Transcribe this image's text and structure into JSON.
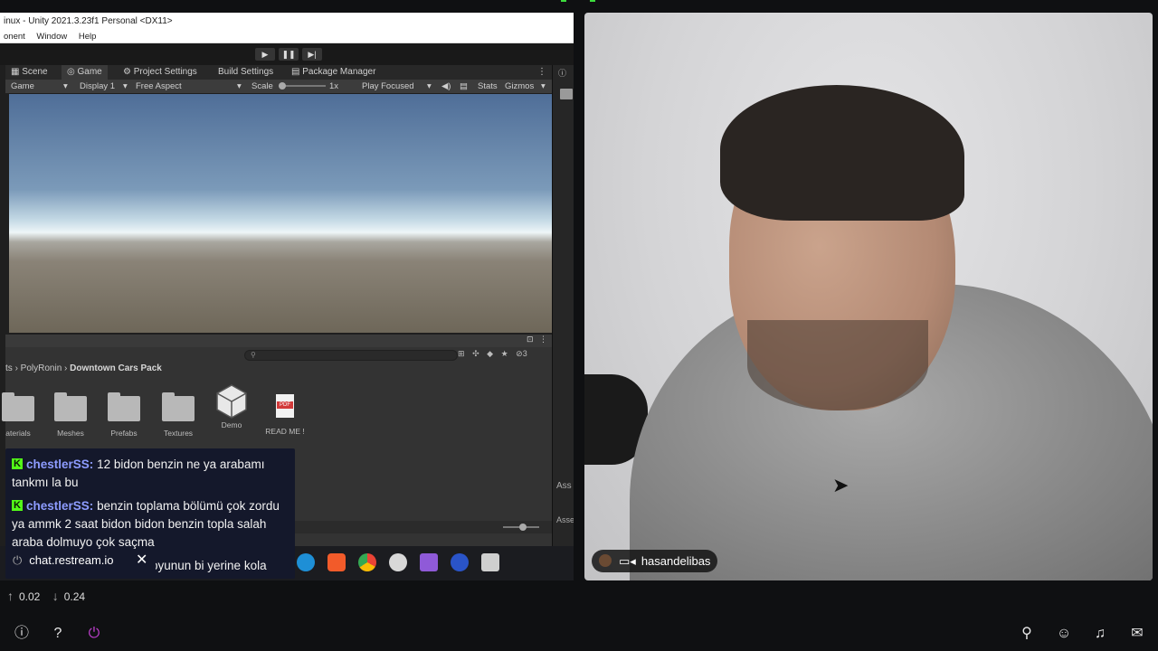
{
  "unity": {
    "window_title": "inux - Unity 2021.3.23f1 Personal <DX11>",
    "menu": [
      "onent",
      "Window",
      "Help"
    ],
    "tabs": [
      "Scene",
      "Game",
      "Project Settings",
      "Build Settings",
      "Package Manager"
    ],
    "game_bar": {
      "view": "Game",
      "display": "Display 1",
      "aspect": "Free Aspect",
      "scale_label": "Scale",
      "scale_value": "1x",
      "play_mode": "Play Focused",
      "stats": "Stats",
      "gizmos": "Gizmos"
    },
    "right_panel_labels": [
      "Ass",
      "Asse"
    ],
    "project": {
      "breadcrumb": [
        "ts",
        "PolyRonin",
        "Downtown Cars Pack"
      ],
      "visible_count": "3",
      "assets": [
        {
          "label": "aterials",
          "kind": "folder"
        },
        {
          "label": "Meshes",
          "kind": "folder"
        },
        {
          "label": "Prefabs",
          "kind": "folder"
        },
        {
          "label": "Textures",
          "kind": "folder"
        },
        {
          "label": "Demo",
          "kind": "unity-scene"
        },
        {
          "label": "READ ME !",
          "kind": "pdf"
        }
      ]
    }
  },
  "chat": {
    "messages": [
      {
        "user": "chestlerSS",
        "text": "12 bidon benzin ne ya arabamı tankmı la bu"
      },
      {
        "user": "chestlerSS",
        "text": "benzin toplama bölümü çok zordu ya ammk 2 saat bidon bidon benzin topla salah araba dolmuyo çok saçma"
      },
      {
        "user": "",
        "text": "oyunun bi yerine kola"
      }
    ],
    "source": "chat.restream.io"
  },
  "webcam": {
    "username": "hasandelibas"
  },
  "network": {
    "upload": "0.02",
    "download": "0.24"
  },
  "colors": {
    "chat_bg": "#14182b",
    "username": "#8d9cff",
    "kick_green": "#53fc18",
    "page_bg": "#0f1012"
  },
  "icons": {
    "bottom_left": [
      "info-icon",
      "help-icon",
      "brand-icon"
    ],
    "bottom_right": [
      "search-icon",
      "profile-icon",
      "notifications-icon",
      "mail-icon"
    ]
  }
}
